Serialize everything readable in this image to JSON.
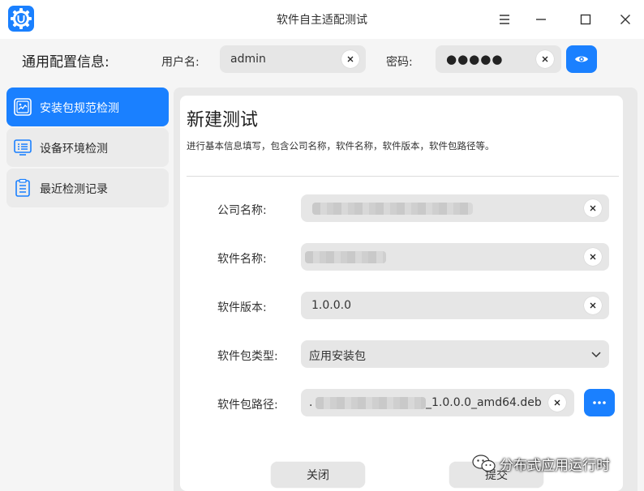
{
  "window": {
    "title": "软件自主适配测试",
    "app_icon": "app-logo-u-icon",
    "controls": [
      "menu-icon",
      "minimize-icon",
      "maximize-icon",
      "close-icon"
    ]
  },
  "config": {
    "heading": "通用配置信息:",
    "username_label": "用户名:",
    "username_value": "admin",
    "password_label": "密码:",
    "password_value": "●●●●●",
    "show_password_icon": "eye-icon"
  },
  "sidebar": {
    "items": [
      {
        "label": "安装包规范检测",
        "icon": "package-check-icon",
        "active": true
      },
      {
        "label": "设备环境检测",
        "icon": "device-list-icon",
        "active": false
      },
      {
        "label": "最近检测记录",
        "icon": "clipboard-icon",
        "active": false
      }
    ]
  },
  "main": {
    "title": "新建测试",
    "description": "进行基本信息填写，包含公司名称，软件名称，软件版本，软件包路径等。",
    "fields": {
      "company": {
        "label": "公司名称:",
        "value": ""
      },
      "software": {
        "label": "软件名称:",
        "value": ""
      },
      "version": {
        "label": "软件版本:",
        "value": "1.0.0.0"
      },
      "package_type": {
        "label": "软件包类型:",
        "value": "应用安装包"
      },
      "package_path": {
        "label": "软件包路径:",
        "value_prefix": ".",
        "value_suffix": "_1.0.0.0_amd64.deb"
      }
    },
    "buttons": {
      "close": "关闭",
      "submit": "提交"
    }
  },
  "watermark": {
    "text": "分布式应用运行时"
  },
  "colors": {
    "accent": "#1a80ff",
    "background": "#f5f5f5",
    "field": "#e6e6e6"
  }
}
